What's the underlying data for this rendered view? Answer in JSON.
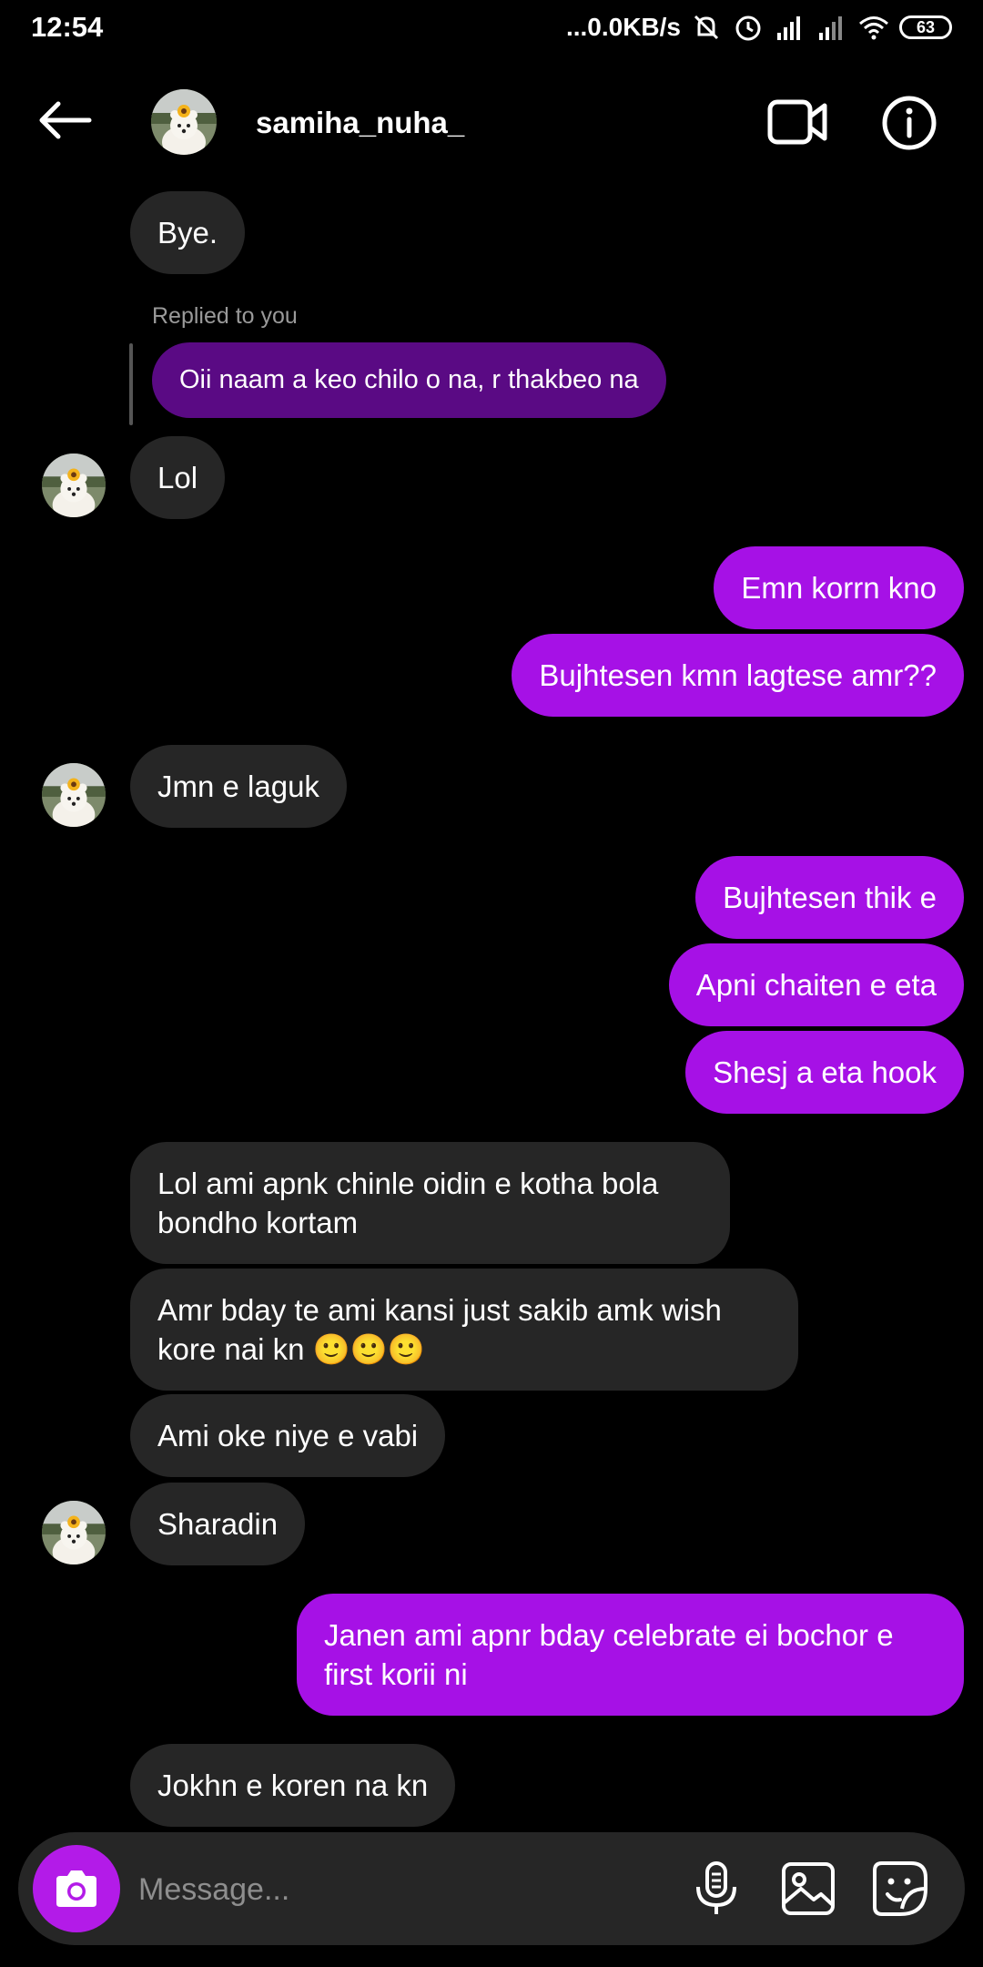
{
  "status_bar": {
    "time": "12:54",
    "network_speed": "...0.0KB/s",
    "battery": "63",
    "icons": [
      "mute-icon",
      "alarm-icon",
      "signal-icon",
      "signal-icon",
      "wifi-icon",
      "battery-icon"
    ]
  },
  "header": {
    "username": "samiha_nuha_",
    "icons": [
      "back-arrow-icon",
      "video-call-icon",
      "info-icon"
    ]
  },
  "reply_context": {
    "label": "Replied to you"
  },
  "messages": [
    {
      "from": "them",
      "text": "Bye."
    },
    {
      "from": "them",
      "text": "Oii naam a keo chilo o na, r thakbeo na",
      "reply": true
    },
    {
      "from": "them",
      "text": "Lol"
    },
    {
      "from": "me",
      "text": "Emn korrn kno"
    },
    {
      "from": "me",
      "text": "Bujhtesen kmn lagtese amr??"
    },
    {
      "from": "them",
      "text": "Jmn e laguk"
    },
    {
      "from": "me",
      "text": "Bujhtesen thik e"
    },
    {
      "from": "me",
      "text": "Apni chaiten e eta"
    },
    {
      "from": "me",
      "text": "Shesj a eta hook"
    },
    {
      "from": "them",
      "text": "Lol ami apnk chinle oidin e kotha bola bondho kortam"
    },
    {
      "from": "them",
      "text": "Amr bday te ami kansi just sakib amk wish kore nai kn 🙂🙂🙂"
    },
    {
      "from": "them",
      "text": "Ami oke niye e vabi"
    },
    {
      "from": "them",
      "text": "Sharadin"
    },
    {
      "from": "me",
      "text": "Janen ami apnr bday celebrate ei bochor e first korii ni"
    },
    {
      "from": "them",
      "text": "Jokhn e koren na kn"
    }
  ],
  "composer": {
    "placeholder": "Message...",
    "icons": [
      "camera-icon",
      "microphone-icon",
      "gallery-icon",
      "sticker-icon"
    ]
  },
  "colors": {
    "background": "#000000",
    "incoming_bubble": "#262626",
    "outgoing_bubble": "#a611e6",
    "reply_bubble": "#5a0a84",
    "camera_button": "#b31be8"
  }
}
